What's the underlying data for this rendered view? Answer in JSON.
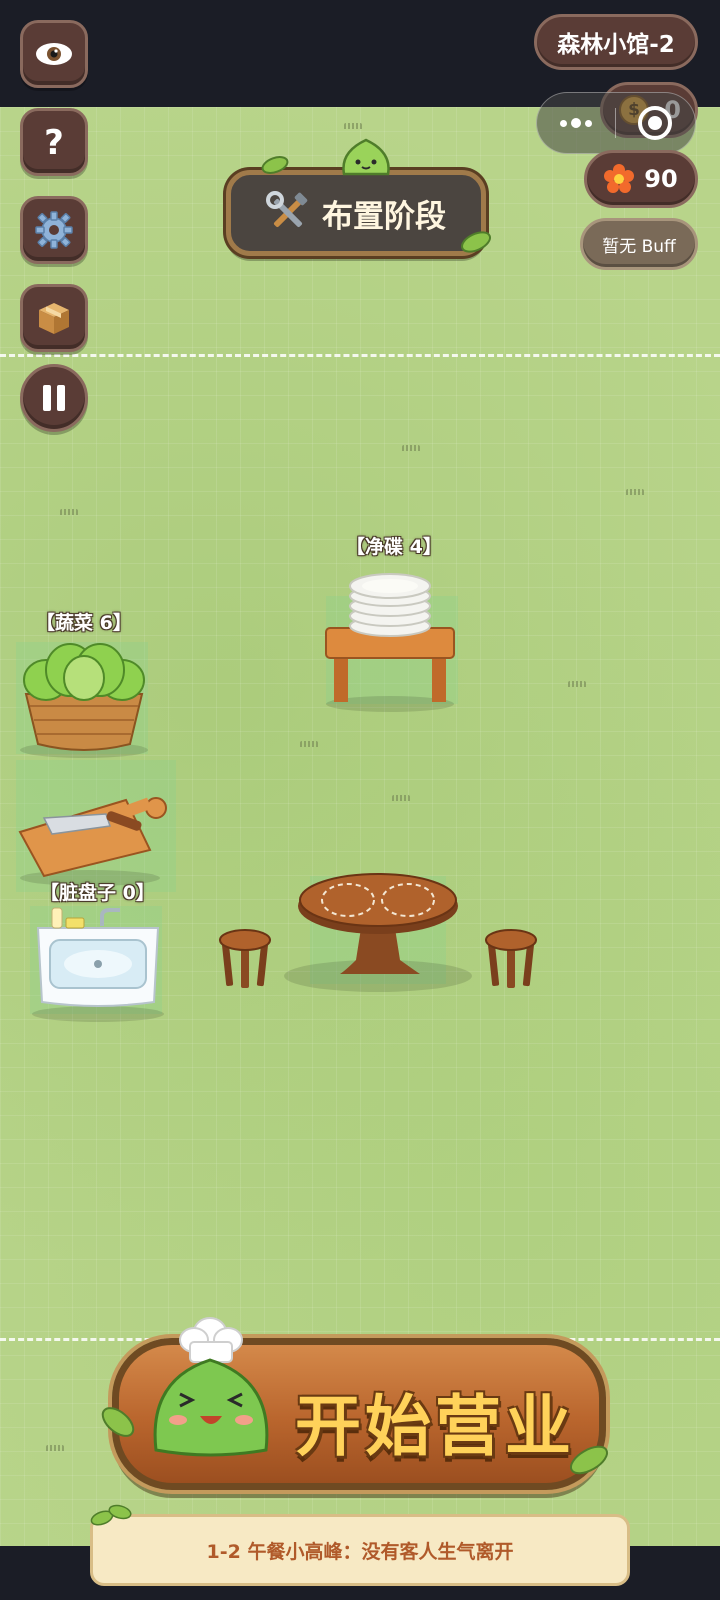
{
  "hud": {
    "level_name": "森林小馆-2",
    "coins": "0",
    "flowers": "90",
    "buff": "暂无 Buff",
    "coin_symbol": "$"
  },
  "phase_banner": {
    "title": "布置阶段"
  },
  "stations": {
    "vegetables": "【蔬菜 6】",
    "clean_plates": "【净碟 4】",
    "dirty_plates": "【脏盘子 0】"
  },
  "start_button": {
    "label": "开始营业"
  },
  "hint": {
    "text": "1-2 午餐小高峰：没有客人生气离开"
  },
  "icons": {
    "side": [
      "eye-icon",
      "question-icon",
      "gear-icon",
      "box-icon",
      "pause-icon"
    ],
    "capsule": [
      "more-dots-icon",
      "record-icon"
    ]
  },
  "colors": {
    "panel_brown": "#5a3c36",
    "field_green": "#b8d48a",
    "start_gold": "#ffd25a",
    "hint_text": "#b05a2a"
  }
}
